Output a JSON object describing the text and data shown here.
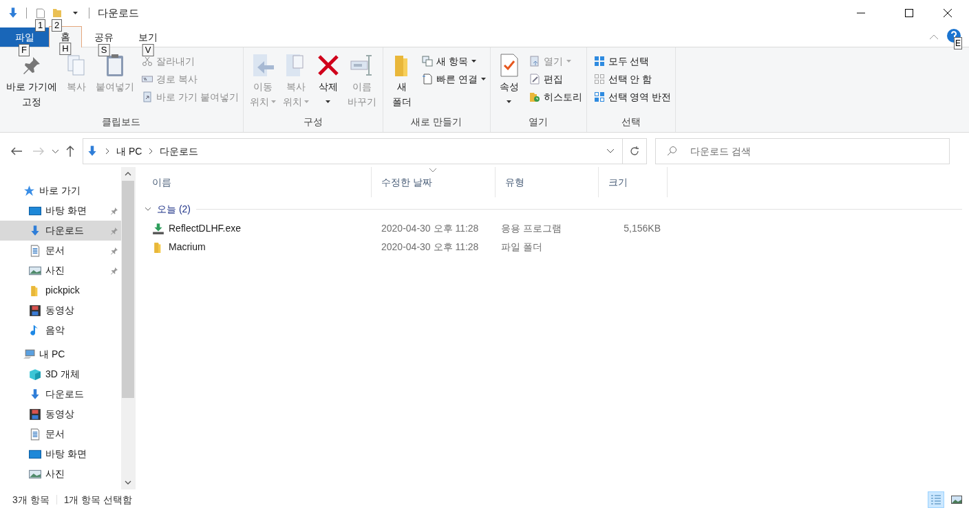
{
  "window": {
    "title": "다운로드",
    "quick_access": [
      {
        "kind": "properties",
        "keytip": "1"
      },
      {
        "kind": "newfolder",
        "keytip": "2"
      }
    ]
  },
  "tabs": [
    {
      "label": "파일",
      "kind": "file",
      "keytip": "F",
      "selected": false
    },
    {
      "label": "홈",
      "kind": "tab",
      "keytip": "H",
      "selected": true
    },
    {
      "label": "공유",
      "kind": "tab",
      "keytip": "S",
      "selected": false
    },
    {
      "label": "보기",
      "kind": "tab",
      "keytip": "V",
      "selected": false
    }
  ],
  "help_keytip": "E",
  "ribbon": [
    {
      "label": "클립보드",
      "items": [
        {
          "kind": "large",
          "lines": [
            "바로 가기에",
            "고정"
          ],
          "disabled": false,
          "dropdown": false
        },
        {
          "kind": "large",
          "lines": [
            "복사"
          ],
          "disabled": true,
          "dropdown": false
        },
        {
          "kind": "large",
          "lines": [
            "붙여넣기"
          ],
          "disabled": true,
          "dropdown": false
        },
        {
          "kind": "stack",
          "items": [
            {
              "label": "잘라내기",
              "disabled": true,
              "dropdown": false
            },
            {
              "label": "경로 복사",
              "disabled": true,
              "dropdown": false
            },
            {
              "label": "바로 가기 붙여넣기",
              "disabled": true,
              "dropdown": false
            }
          ]
        }
      ]
    },
    {
      "label": "구성",
      "items": [
        {
          "kind": "large",
          "lines": [
            "이동",
            "위치"
          ],
          "disabled": true,
          "dropdown": true
        },
        {
          "kind": "large",
          "lines": [
            "복사",
            "위치"
          ],
          "disabled": true,
          "dropdown": true
        },
        {
          "kind": "large",
          "lines": [
            "삭제"
          ],
          "disabled": false,
          "dropdown": true
        },
        {
          "kind": "large",
          "lines": [
            "이름",
            "바꾸기"
          ],
          "disabled": true,
          "dropdown": false
        }
      ]
    },
    {
      "label": "새로 만들기",
      "items": [
        {
          "kind": "large",
          "lines": [
            "새",
            "폴더"
          ],
          "disabled": false,
          "dropdown": false
        },
        {
          "kind": "stack",
          "items": [
            {
              "label": "새 항목",
              "disabled": false,
              "dropdown": true
            },
            {
              "label": "빠른 연결",
              "disabled": false,
              "dropdown": true
            }
          ]
        }
      ]
    },
    {
      "label": "열기",
      "items": [
        {
          "kind": "large",
          "lines": [
            "속성"
          ],
          "disabled": false,
          "dropdown": true
        },
        {
          "kind": "stack",
          "items": [
            {
              "label": "열기",
              "disabled": true,
              "dropdown": true
            },
            {
              "label": "편집",
              "disabled": false,
              "dropdown": false
            },
            {
              "label": "히스토리",
              "disabled": false,
              "dropdown": false
            }
          ]
        }
      ]
    },
    {
      "label": "선택",
      "items": [
        {
          "kind": "stack",
          "items": [
            {
              "label": "모두 선택",
              "disabled": false,
              "dropdown": false
            },
            {
              "label": "선택 안 함",
              "disabled": false,
              "dropdown": false
            },
            {
              "label": "선택 영역 반전",
              "disabled": false,
              "dropdown": false
            }
          ]
        }
      ]
    }
  ],
  "nav": {
    "back_disabled": false,
    "forward_disabled": true,
    "breadcrumbs": [
      "내 PC",
      "다운로드"
    ],
    "search": {
      "placeholder": "다운로드 검색"
    }
  },
  "sidebar": {
    "items": [
      {
        "kind": "header",
        "label": "바로 가기",
        "pinned": false,
        "selected": false
      },
      {
        "kind": "item",
        "label": "바탕 화면",
        "pinned": true,
        "selected": false
      },
      {
        "kind": "item",
        "label": "다운로드",
        "pinned": true,
        "selected": true
      },
      {
        "kind": "item",
        "label": "문서",
        "pinned": true,
        "selected": false
      },
      {
        "kind": "item",
        "label": "사진",
        "pinned": true,
        "selected": false
      },
      {
        "kind": "item",
        "label": "pickpick",
        "pinned": false,
        "selected": false
      },
      {
        "kind": "item",
        "label": "동영상",
        "pinned": false,
        "selected": false
      },
      {
        "kind": "item",
        "label": "음악",
        "pinned": false,
        "selected": false
      },
      {
        "kind": "header",
        "label": "내 PC",
        "pinned": false,
        "selected": false
      },
      {
        "kind": "item",
        "label": "3D 개체",
        "pinned": false,
        "selected": false
      },
      {
        "kind": "item",
        "label": "다운로드",
        "pinned": false,
        "selected": false
      },
      {
        "kind": "item",
        "label": "동영상",
        "pinned": false,
        "selected": false
      },
      {
        "kind": "item",
        "label": "문서",
        "pinned": false,
        "selected": false
      },
      {
        "kind": "item",
        "label": "바탕 화면",
        "pinned": false,
        "selected": false
      },
      {
        "kind": "item",
        "label": "사진",
        "pinned": false,
        "selected": false
      }
    ]
  },
  "table": {
    "columns": [
      {
        "label": "이름",
        "sorted": false
      },
      {
        "label": "수정한 날짜",
        "sorted": true
      },
      {
        "label": "유형",
        "sorted": false
      },
      {
        "label": "크기",
        "sorted": false
      }
    ],
    "groups": [
      {
        "label": "오늘 (2)",
        "expanded": true,
        "rows": [
          {
            "name": "ReflectDLHF.exe",
            "date": "2020-04-30 오후 11:28",
            "type": "응용 프로그램",
            "size": "5,156KB"
          },
          {
            "name": "Macrium",
            "date": "2020-04-30 오후 11:28",
            "type": "파일 폴더"
          }
        ]
      }
    ]
  },
  "status_bar": {
    "items": [
      "3개 항목",
      "1개 항목 선택함"
    ],
    "views": [
      {
        "kind": "details",
        "selected": true
      },
      {
        "kind": "large",
        "selected": false
      }
    ]
  }
}
